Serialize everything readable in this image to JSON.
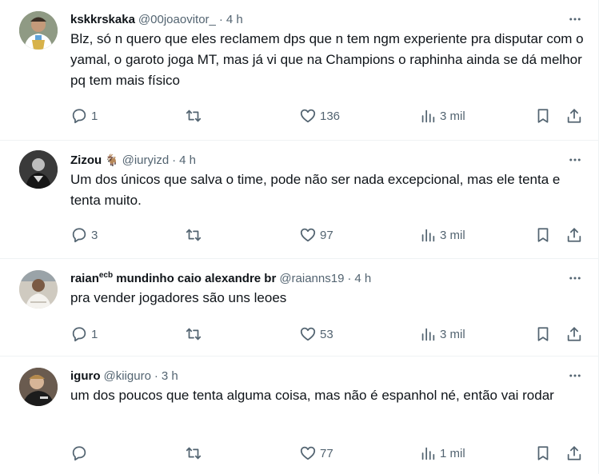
{
  "tweets": [
    {
      "name": "kskkrskaka",
      "name_sup": "",
      "badge_emoji": "",
      "handle": "@00joaovitor_",
      "time": "4 h",
      "text": "Blz, só n quero que eles reclamem dps que n tem ngm experiente pra disputar com o yamal, o garoto joga MT, mas já vi que na Champions o raphinha ainda se dá melhor pq tem mais físico",
      "replies": "1",
      "retweets": "",
      "likes": "136",
      "views": "3 mil"
    },
    {
      "name": "Zizou",
      "name_sup": "",
      "badge_emoji": "🐐",
      "handle": "@iuryizd",
      "time": "4 h",
      "text": "Um dos únicos que salva o time, pode não ser nada excepcional, mas ele tenta e tenta muito.",
      "replies": "3",
      "retweets": "",
      "likes": "97",
      "views": "3 mil"
    },
    {
      "name": "raian",
      "name_sup": "ecb",
      "name_rest": " mundinho caio alexandre br",
      "badge_emoji": "",
      "handle": "@raianns19",
      "time": "4 h",
      "text": "pra vender jogadores são uns leoes",
      "replies": "1",
      "retweets": "",
      "likes": "53",
      "views": "3 mil"
    },
    {
      "name": "iguro",
      "name_sup": "",
      "badge_emoji": "",
      "handle": "@kiiguro",
      "time": "3 h",
      "text": "um dos poucos que tenta alguma coisa, mas não é espanhol né, então vai rodar",
      "replies": "",
      "retweets": "",
      "likes": "77",
      "views": "1 mil"
    }
  ],
  "icons": {
    "more": "more-dots-icon",
    "reply": "reply-icon",
    "retweet": "retweet-icon",
    "like": "heart-icon",
    "views": "views-icon",
    "bookmark": "bookmark-icon",
    "share": "share-icon"
  },
  "colors": {
    "text": "#0f1419",
    "secondary": "#536471",
    "border": "#eff3f4"
  }
}
